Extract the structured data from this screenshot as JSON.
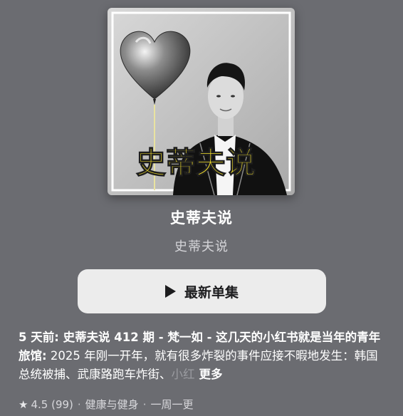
{
  "podcast": {
    "cover_text": "史蒂夫说",
    "title": "史蒂夫说",
    "author": "史蒂夫说"
  },
  "play_button": {
    "label": "最新单集",
    "icon": "play-icon"
  },
  "episode": {
    "description_lead": "5 天前: 史蒂夫说 412 期 - 梵一如 - 这几天的小红书就是当年的青年旅馆:",
    "description_body": " 2025 年刚一开年，就有很多炸裂的事件应接不暇地发生：韩国总统被捕、武康路跑车炸街、",
    "description_fade": "小红",
    "more_label": "更多"
  },
  "meta": {
    "star_icon": "star-icon",
    "rating": "4.5",
    "rating_count": "(99)",
    "category": "健康与健身",
    "frequency": "一周一更",
    "separator": "·"
  },
  "colors": {
    "background": "#6b6c71",
    "button_bg": "#ececec",
    "cover_title_yellow": "#f4e02a"
  }
}
